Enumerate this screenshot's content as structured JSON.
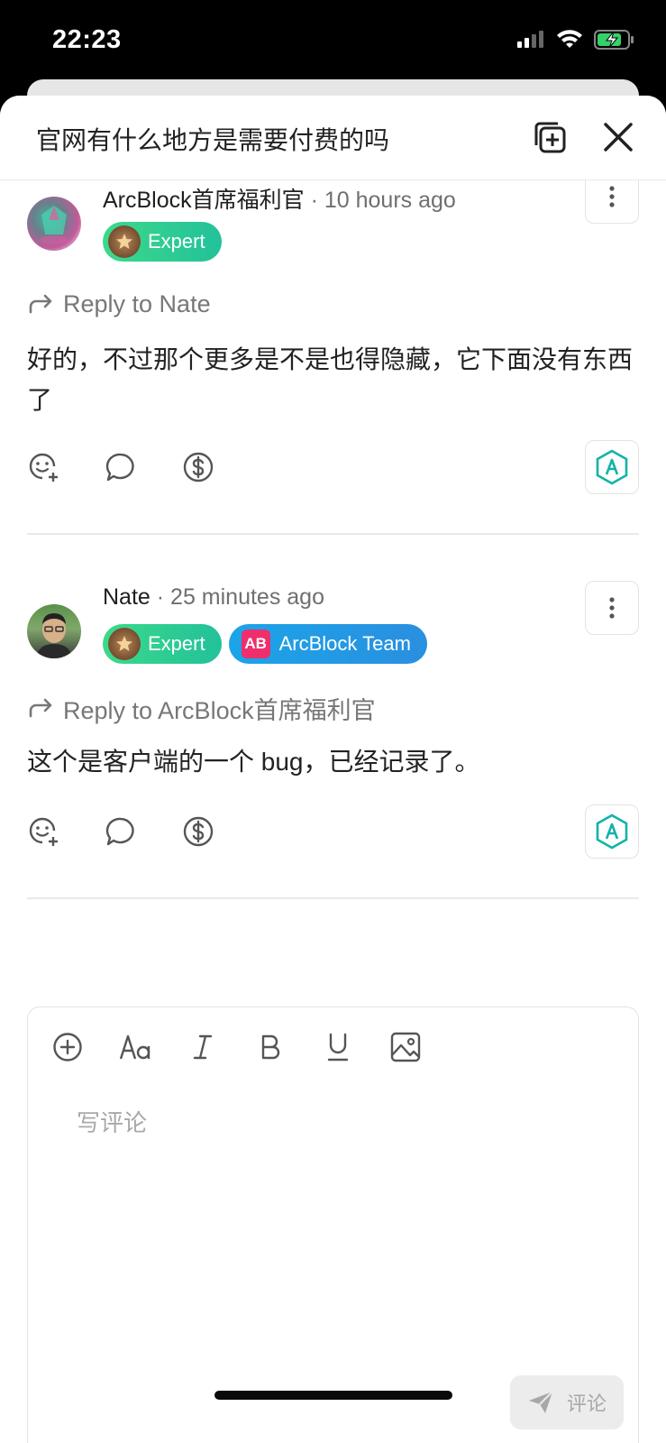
{
  "status_bar": {
    "time": "22:23"
  },
  "sheet": {
    "title": "官网有什么地方是需要付费的吗"
  },
  "comments": [
    {
      "author": "ArcBlock首席福利官",
      "time_ago": "· 10 hours ago",
      "badges": [
        {
          "label": "Expert",
          "icon": "expert-medal-icon"
        }
      ],
      "reply_to": "Reply to Nate",
      "body": "好的，不过那个更多是不是也得隐藏，它下面没有东西了"
    },
    {
      "author": "Nate",
      "time_ago": "· 25 minutes ago",
      "badges": [
        {
          "label": "Expert",
          "icon": "expert-medal-icon"
        },
        {
          "label": "ArcBlock Team",
          "icon_text": "AB"
        }
      ],
      "reply_to": "Reply to ArcBlock首席福利官",
      "body": "这个是客户端的一个 bug，已经记录了。"
    }
  ],
  "editor": {
    "placeholder": "写评论",
    "submit_label": "评论",
    "tools": [
      "add-icon",
      "text-style-icon",
      "italic-icon",
      "bold-icon",
      "underline-icon",
      "image-icon"
    ]
  },
  "colors": {
    "expert_badge": "#2fcf90",
    "team_badge": "#1f9ae6",
    "arc_accent": "#12b3a8"
  }
}
